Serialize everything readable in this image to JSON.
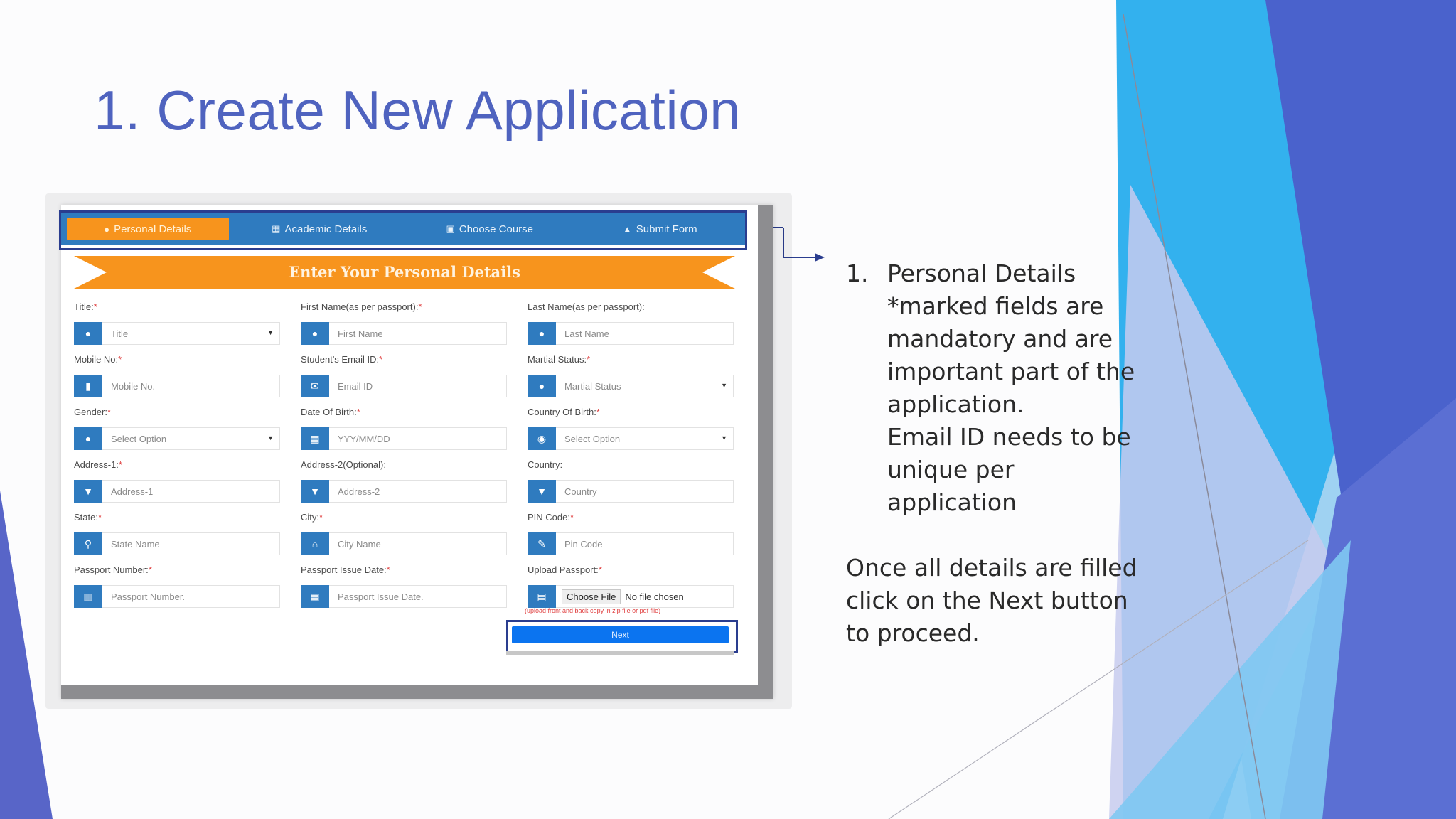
{
  "slide": {
    "title": "1. Create New Application"
  },
  "form": {
    "tabs": [
      {
        "label": "Personal Details",
        "icon": "user-icon",
        "active": true
      },
      {
        "label": "Academic Details",
        "icon": "institution-icon",
        "active": false
      },
      {
        "label": "Choose Course",
        "icon": "save-icon",
        "active": false
      },
      {
        "label": "Submit Form",
        "icon": "upload-icon",
        "active": false
      }
    ],
    "banner": "Enter Your Personal Details",
    "fields": [
      {
        "label": "Title:",
        "required": "*",
        "placeholder": "Title",
        "icon": "user-icon",
        "select": true
      },
      {
        "label": "First Name(as per passport):",
        "required": "*",
        "placeholder": "First Name",
        "icon": "user-icon",
        "select": false
      },
      {
        "label": "Last Name(as per passport):",
        "required": "",
        "placeholder": "Last Name",
        "icon": "user-icon",
        "select": false
      },
      {
        "label": "Mobile No:",
        "required": "*",
        "placeholder": "Mobile No.",
        "icon": "phone-icon",
        "select": false
      },
      {
        "label": "Student's Email ID:",
        "required": "*",
        "placeholder": "Email ID",
        "icon": "envelope-icon",
        "select": false
      },
      {
        "label": "Martial Status:",
        "required": "*",
        "placeholder": "Martial Status",
        "icon": "user-icon",
        "select": true
      },
      {
        "label": "Gender:",
        "required": "*",
        "placeholder": "Select Option",
        "icon": "user-icon",
        "select": true
      },
      {
        "label": "Date Of Birth:",
        "required": "*",
        "placeholder": "YYY/MM/DD",
        "icon": "calendar-icon",
        "select": false
      },
      {
        "label": "Country Of Birth:",
        "required": "*",
        "placeholder": "Select Option",
        "icon": "globe-icon",
        "select": true
      },
      {
        "label": "Address-1:",
        "required": "*",
        "placeholder": "Address-1",
        "icon": "map-marker-icon",
        "select": false
      },
      {
        "label": "Address-2(Optional):",
        "required": "",
        "placeholder": "Address-2",
        "icon": "map-marker-icon",
        "select": false
      },
      {
        "label": "Country:",
        "required": "",
        "placeholder": "Country",
        "icon": "map-marker-icon",
        "select": false
      },
      {
        "label": "State:",
        "required": "*",
        "placeholder": "State Name",
        "icon": "search-icon",
        "select": false
      },
      {
        "label": "City:",
        "required": "*",
        "placeholder": "City Name",
        "icon": "home-icon",
        "select": false
      },
      {
        "label": "PIN Code:",
        "required": "*",
        "placeholder": "Pin Code",
        "icon": "pencil-icon",
        "select": false
      },
      {
        "label": "Passport Number:",
        "required": "*",
        "placeholder": "Passport Number.",
        "icon": "book-icon",
        "select": false
      },
      {
        "label": "Passport Issue Date:",
        "required": "*",
        "placeholder": "Passport Issue Date.",
        "icon": "calendar-icon",
        "select": false
      },
      {
        "label": "Upload Passport:",
        "required": "*",
        "placeholder": "",
        "icon": "id-card-icon",
        "select": false,
        "file": true
      }
    ],
    "upload": {
      "button": "Choose File",
      "status": "No file chosen",
      "note": "(upload front and back copy in zip file or pdf file)"
    },
    "next_label": "Next"
  },
  "notes": {
    "number": "1.",
    "lines": [
      "Personal Details",
      "*marked fields are",
      "mandatory and are",
      "important part of the",
      "application.",
      "Email ID needs to be",
      "unique per",
      "application"
    ],
    "paragraph_lines": [
      "Once all details are filled",
      "click on the Next button",
      "to proceed."
    ]
  },
  "colors": {
    "title": "#4f63bf",
    "tab_bar": "#2f7bbf",
    "active_tab": "#f7941d",
    "banner": "#f7941d",
    "next_button": "#0b74f0",
    "highlight_box": "#2a3d8f"
  }
}
